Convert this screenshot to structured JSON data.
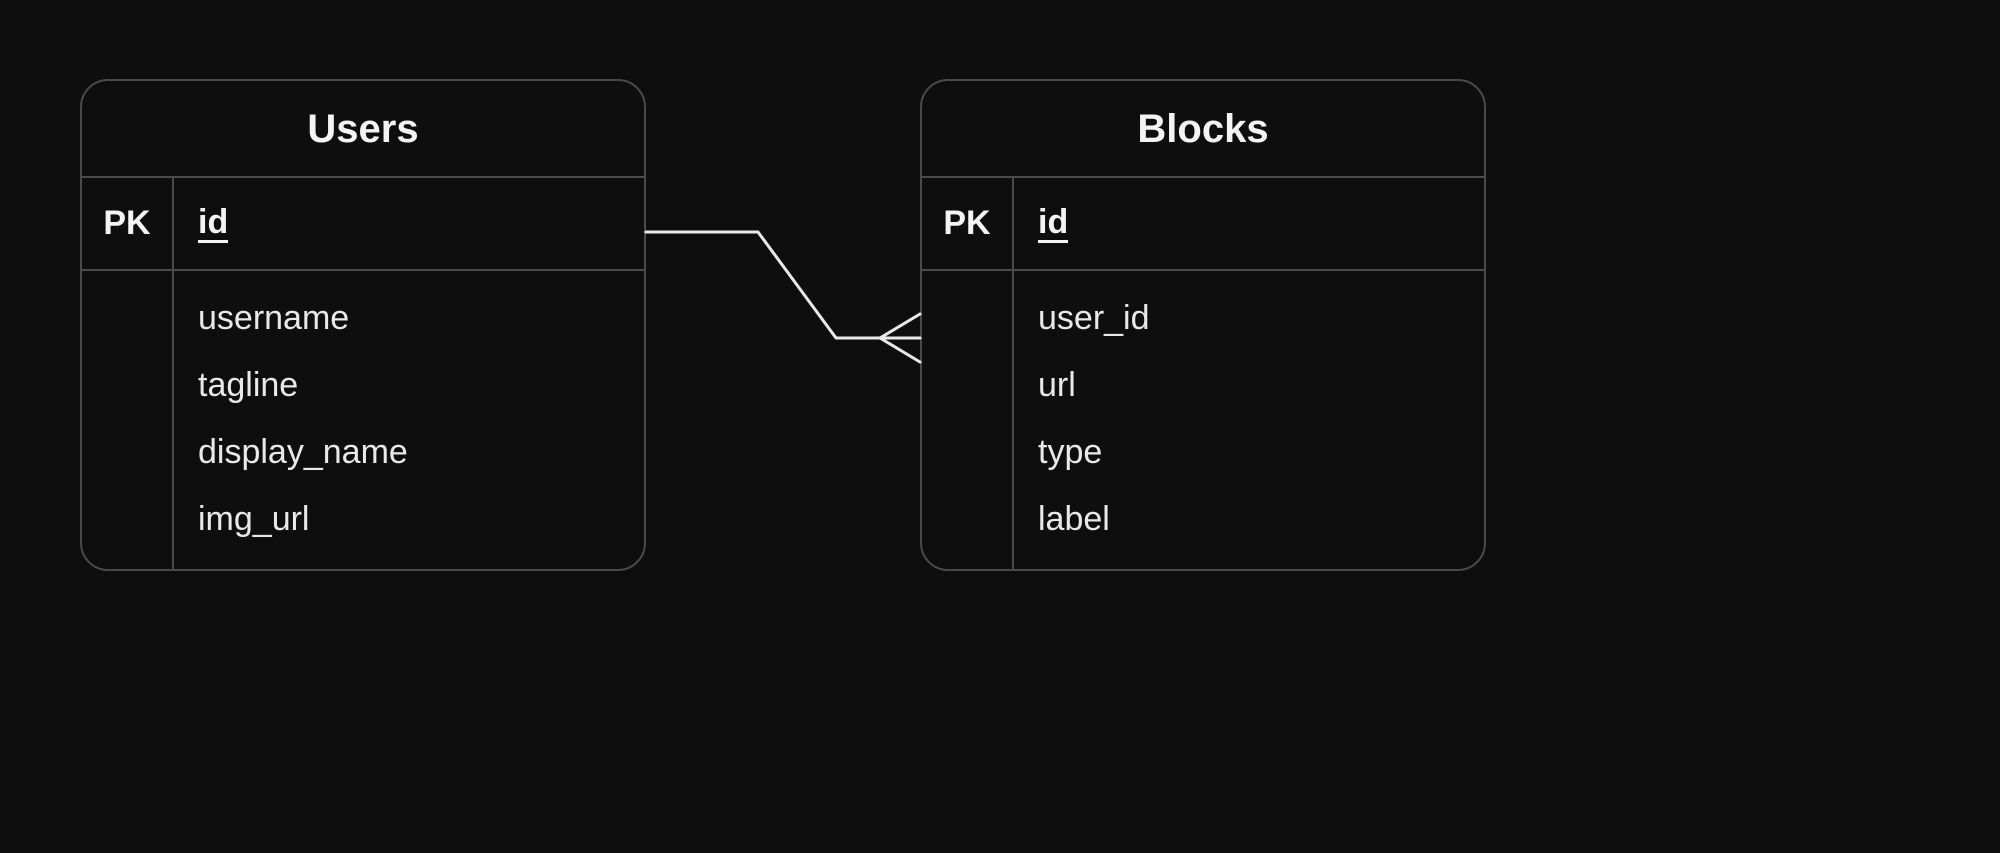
{
  "entities": [
    {
      "title": "Users",
      "pk_label": "PK",
      "pk_field": "id",
      "fields": [
        "username",
        "tagline",
        "display_name",
        "img_url"
      ]
    },
    {
      "title": "Blocks",
      "pk_label": "PK",
      "pk_field": "id",
      "fields": [
        "user_id",
        "url",
        "type",
        "label"
      ]
    }
  ],
  "relation": {
    "from": "Users.id",
    "to": "Blocks.user_id",
    "type": "one-to-many"
  }
}
